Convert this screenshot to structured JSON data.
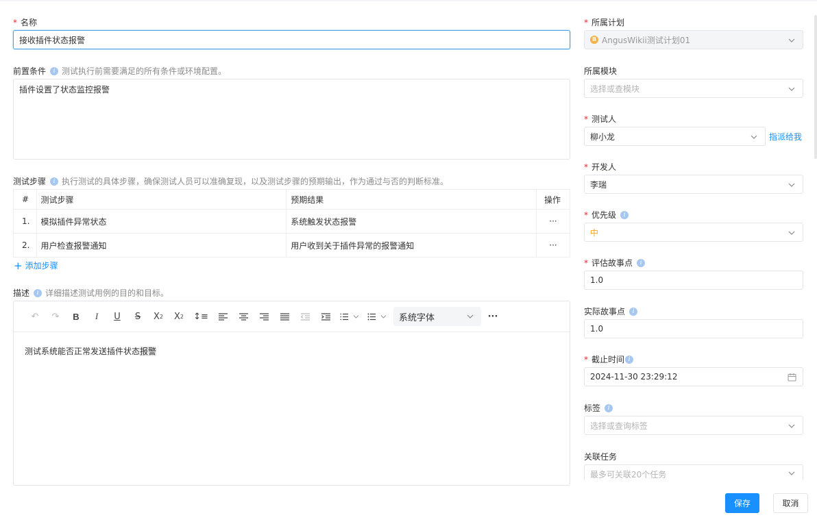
{
  "form": {
    "name": {
      "label": "名称",
      "value": "接收插件状态报警"
    },
    "precondition": {
      "label": "前置条件",
      "hint": "测试执行前需要满足的所有条件或环境配置。",
      "value": "插件设置了状态监控报警"
    },
    "steps": {
      "label": "测试步骤",
      "hint": "执行测试的具体步骤，确保测试人员可以准确复现，以及测试步骤的预期输出，作为通过与否的判断标准。",
      "columns": {
        "index": "#",
        "step": "测试步骤",
        "expected": "预期结果",
        "action": "操作"
      },
      "rows": [
        {
          "index": "1.",
          "step": "模拟插件异常状态",
          "expected": "系统触发状态报警",
          "more": "···"
        },
        {
          "index": "2.",
          "step": "用户检查报警通知",
          "expected": "用户收到关于插件异常的报警通知",
          "more": "···"
        }
      ],
      "add_label": "添加步骤"
    },
    "description": {
      "label": "描述",
      "hint": "详细描述测试用例的目的和目标。",
      "font_select": "系统字体",
      "content_plain": "测试系统能否正常发送插件状态",
      "content_highlight": "报警"
    }
  },
  "side": {
    "plan": {
      "label": "所属计划",
      "value": "AngusWikii测试计划01"
    },
    "module": {
      "label": "所属模块",
      "placeholder": "选择或查模块"
    },
    "tester": {
      "label": "测试人",
      "value": "柳小龙",
      "assign_me": "指派给我"
    },
    "developer": {
      "label": "开发人",
      "value": "李瑞"
    },
    "priority": {
      "label": "优先级",
      "value": "中",
      "color": "#f5a623"
    },
    "estimate": {
      "label": "评估故事点",
      "value": "1.0"
    },
    "actual": {
      "label": "实际故事点",
      "value": "1.0"
    },
    "deadline": {
      "label": "截止时间",
      "value": "2024-11-30 23:29:12"
    },
    "tags": {
      "label": "标签",
      "placeholder": "选择或查询标签"
    },
    "tasks": {
      "label": "关联任务",
      "placeholder": "最多可关联20个任务"
    }
  },
  "footer": {
    "save": "保存",
    "cancel": "取消"
  }
}
